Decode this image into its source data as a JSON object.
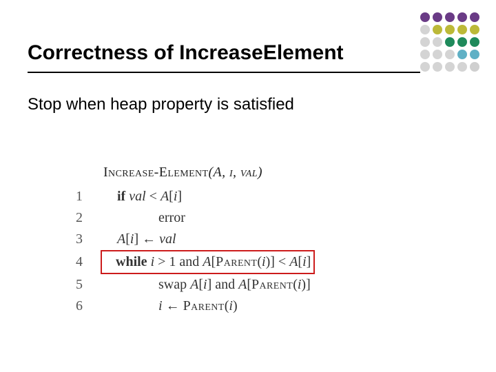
{
  "title": "Correctness of IncreaseElement",
  "subheading": "Stop when heap property is satisfied",
  "logo_colors": {
    "row1": [
      "#6a3b86",
      "#6a3b86",
      "#6a3b86",
      "#6a3b86",
      "#6a3b86"
    ],
    "row2": [
      "#d4d4d4",
      "#bcb938",
      "#bcb938",
      "#bcb938",
      "#bcb938"
    ],
    "row3": [
      "#d4d4d4",
      "#d4d4d4",
      "#1f8a5b",
      "#1f8a5b",
      "#1f8a5b"
    ],
    "row4": [
      "#d4d4d4",
      "#d4d4d4",
      "#d4d4d4",
      "#5fb0c5",
      "#5fb0c5"
    ],
    "row5": [
      "#d4d4d4",
      "#d4d4d4",
      "#d4d4d4",
      "#d4d4d4",
      "#cfcfcf"
    ]
  },
  "code": {
    "name": "Increase-Element",
    "args": "(A, i, val)",
    "highlight_line": 4,
    "lines": [
      {
        "n": "1",
        "indent": 1,
        "content": "if val < A[i]"
      },
      {
        "n": "2",
        "indent": 2,
        "content": "error"
      },
      {
        "n": "3",
        "indent": 1,
        "content": "A[i] ← val"
      },
      {
        "n": "4",
        "indent": 1,
        "content": "while i > 1 and A[Parent(i)] < A[i]"
      },
      {
        "n": "5",
        "indent": 2,
        "content": "swap A[i] and A[Parent(i)]"
      },
      {
        "n": "6",
        "indent": 2,
        "content": "i ← Parent(i)"
      }
    ]
  }
}
